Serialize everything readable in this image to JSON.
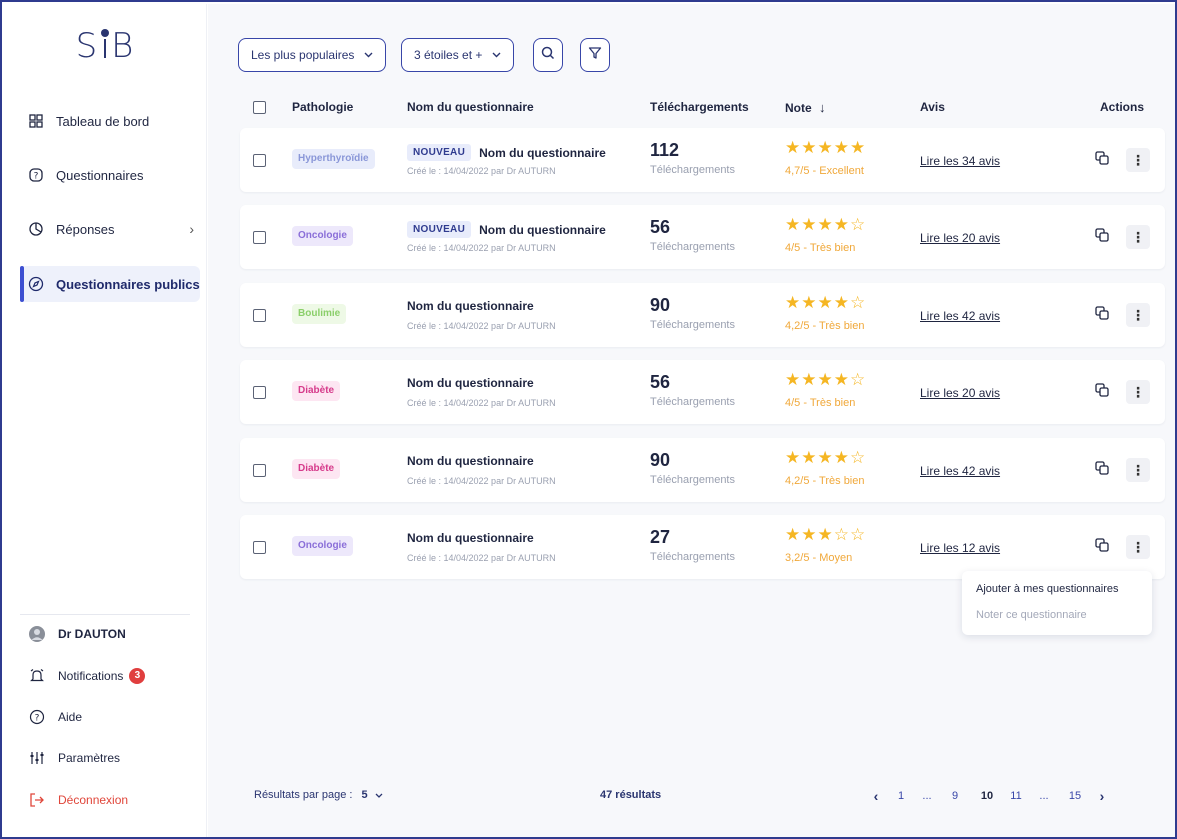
{
  "app": {
    "logo": "S B"
  },
  "sidebar": {
    "items": [
      {
        "label": "Tableau de bord",
        "icon": "grid-icon"
      },
      {
        "label": "Questionnaires",
        "icon": "question-doc-icon"
      },
      {
        "label": "Réponses",
        "icon": "pie-chart-icon",
        "has_chevron": true
      },
      {
        "label": "Questionnaires publics",
        "icon": "compass-icon",
        "active": true
      }
    ],
    "user": {
      "name": "Dr DAUTON"
    },
    "bottom": [
      {
        "label": "Notifications",
        "icon": "bell-icon",
        "badge": "3"
      },
      {
        "label": "Aide",
        "icon": "help-icon"
      },
      {
        "label": "Paramètres",
        "icon": "sliders-icon"
      },
      {
        "label": "Déconnexion",
        "icon": "logout-icon"
      }
    ]
  },
  "filters": {
    "sort": "Les plus populaires",
    "rating": "3 étoiles et +",
    "search_icon": "search-icon",
    "filter_icon": "filter-icon"
  },
  "table": {
    "headers": {
      "pathologie": "Pathologie",
      "nom": "Nom du questionnaire",
      "telechargements": "Téléchargements",
      "note": "Note",
      "note_sort_icon": "↓",
      "avis": "Avis",
      "actions": "Actions"
    },
    "rows": [
      {
        "pathologie": "Hyperthyroïdie",
        "tag_color": "#e8ecfb",
        "tag_text": "#8a97d8",
        "new": "NOUVEAU",
        "title": "Nom du questionnaire",
        "subtitle": "Créé le : 14/04/2022 par Dr AUTURN",
        "downloads": "112",
        "downloads_label": "Téléchargements",
        "stars": 5,
        "rating": "4,7/5 - Excellent",
        "reviews": "Lire les 34 avis"
      },
      {
        "pathologie": "Oncologie",
        "tag_color": "#ede8fb",
        "tag_text": "#8a6ed8",
        "new": "NOUVEAU",
        "title": "Nom du questionnaire",
        "subtitle": "Créé le : 14/04/2022 par Dr AUTURN",
        "downloads": "56",
        "downloads_label": "Téléchargements",
        "stars": 4,
        "rating": "4/5 - Très bien",
        "reviews": "Lire les 20 avis"
      },
      {
        "pathologie": "Boulimie",
        "tag_color": "#eef9e6",
        "tag_text": "#8bcf6a",
        "new": "",
        "title": "Nom du questionnaire",
        "subtitle": "Créé le : 14/04/2022 par Dr AUTURN",
        "downloads": "90",
        "downloads_label": "Téléchargements",
        "stars": 4,
        "rating": "4,2/5 - Très bien",
        "reviews": "Lire les 42 avis"
      },
      {
        "pathologie": "Diabète",
        "tag_color": "#fde6f2",
        "tag_text": "#d63b8b",
        "new": "",
        "title": "Nom du questionnaire",
        "subtitle": "Créé le : 14/04/2022 par Dr AUTURN",
        "downloads": "56",
        "downloads_label": "Téléchargements",
        "stars": 4,
        "rating": "4/5 - Très bien",
        "reviews": "Lire les 20 avis"
      },
      {
        "pathologie": "Diabète",
        "tag_color": "#fde6f2",
        "tag_text": "#d63b8b",
        "new": "",
        "title": "Nom du questionnaire",
        "subtitle": "Créé le : 14/04/2022 par Dr AUTURN",
        "downloads": "90",
        "downloads_label": "Téléchargements",
        "stars": 4,
        "rating": "4,2/5 - Très bien",
        "reviews": "Lire les 42 avis"
      },
      {
        "pathologie": "Oncologie",
        "tag_color": "#ede8fb",
        "tag_text": "#8a6ed8",
        "new": "",
        "title": "Nom du questionnaire",
        "subtitle": "Créé le : 14/04/2022 par Dr AUTURN",
        "downloads": "27",
        "downloads_label": "Téléchargements",
        "stars": 3,
        "rating": "3,2/5 - Moyen",
        "reviews": "Lire les 12 avis"
      }
    ]
  },
  "dropdown": {
    "options": [
      "Ajouter à mes questionnaires",
      "Noter ce questionnaire"
    ]
  },
  "footer": {
    "per_page_label": "Résultats par page :",
    "per_page_value": "5",
    "results": "47 résultats",
    "pages": [
      "1",
      "...",
      "9",
      "10",
      "11",
      "...",
      "15"
    ],
    "current_page": "10"
  },
  "colors": {
    "accent": "#3846a8",
    "star": "#f5b623",
    "danger": "#e03e3e"
  }
}
